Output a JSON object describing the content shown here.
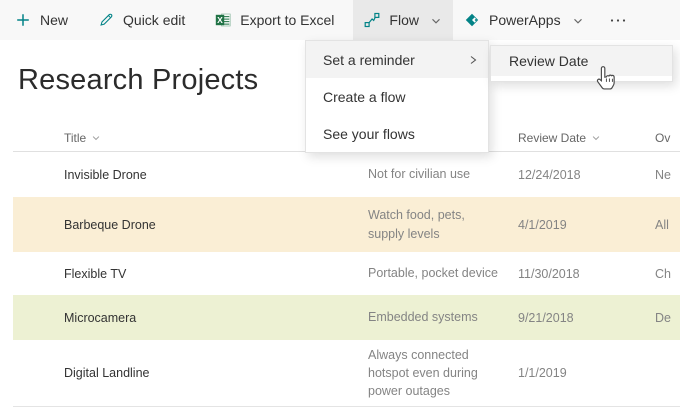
{
  "colors": {
    "accent_teal": "#038387",
    "excel_green": "#217346",
    "command_bar_bg": "#f8f8f8",
    "pressed_item_bg": "#e9e9e9",
    "menu_hover_bg": "#f3f3f3",
    "row_highlight_cream": "#faeed5",
    "row_highlight_green": "#edf1d3"
  },
  "command_bar": {
    "items": [
      {
        "label": "New",
        "icon": "plus-icon"
      },
      {
        "label": "Quick edit",
        "icon": "pencil-icon"
      },
      {
        "label": "Export to Excel",
        "icon": "excel-icon"
      },
      {
        "label": "Flow",
        "icon": "flow-icon",
        "chevron": true,
        "state": "menu-open"
      },
      {
        "label": "PowerApps",
        "icon": "powerapps-icon",
        "chevron": true
      },
      {
        "label": "",
        "icon": "ellipsis-icon"
      }
    ]
  },
  "flow_menu": {
    "items": [
      {
        "label": "Set a reminder",
        "has_submenu": true,
        "hovered": true
      },
      {
        "label": "Create a flow"
      },
      {
        "label": "See your flows"
      }
    ]
  },
  "submenu": {
    "items": [
      {
        "label": "Review Date"
      }
    ]
  },
  "page": {
    "title": "Research Projects"
  },
  "table": {
    "columns": {
      "title": "Title",
      "review_date": "Review Date",
      "owner": "Ov"
    },
    "rows": [
      {
        "title": "Invisible Drone",
        "description": "Not for civilian use",
        "review_date": "12/24/2018",
        "owner": "Ne",
        "highlight": "none"
      },
      {
        "title": "Barbeque Drone",
        "description": "Watch food, pets, supply levels",
        "review_date": "4/1/2019",
        "owner": "All",
        "highlight": "cream"
      },
      {
        "title": "Flexible TV",
        "description": "Portable, pocket device",
        "review_date": "11/30/2018",
        "owner": "Ch",
        "highlight": "none"
      },
      {
        "title": "Microcamera",
        "description": "Embedded systems",
        "review_date": "9/21/2018",
        "owner": "De",
        "highlight": "green"
      },
      {
        "title": "Digital Landline",
        "description": "Always connected hotspot even during power outages",
        "review_date": "1/1/2019",
        "owner": "",
        "highlight": "none"
      }
    ]
  }
}
